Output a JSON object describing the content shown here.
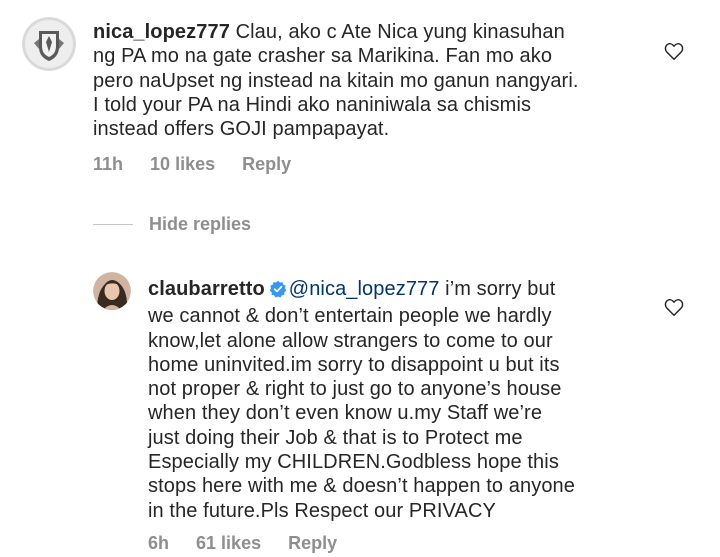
{
  "comments": [
    {
      "username": "nica_lopez777",
      "body": " Clau, ako c Ate Nica yung kinasuhan\nng PA mo na gate crasher sa Marikina. Fan mo ako\npero naUpset ng instead na kitain mo ganun nangyari.\nI told your PA na Hindi ako naniniwala sa chismis\ninstead offers GOJI pampapayat.",
      "time": "11h",
      "likes": "10 likes",
      "reply": "Reply",
      "avatar": "crest-avatar"
    },
    {
      "username": "claubarretto",
      "verified": true,
      "mention": "@nica_lopez777",
      "body_first": " i’m sorry but",
      "body": "we cannot & don’t entertain people we hardly\nknow,let alone allow strangers to come to our\nhome uninvited.im sorry to disappoint u but its\nnot proper & right to just go to anyone’s house\nwhen they don’t even know u.my Staff we’re\njust doing their Job & that is to Protect me\nEspecially my CHILDREN.Godbless hope this\nstops here with me & doesn’t happen to anyone\nin the future.Pls Respect our PRIVACY",
      "time": "6h",
      "likes": "61 likes",
      "reply": "Reply",
      "avatar": "profile-photo-avatar"
    }
  ],
  "hide_replies": "Hide replies",
  "colors": {
    "text": "#262626",
    "meta": "#8e8e8e",
    "mention": "#00376b",
    "verified": "#3897f0"
  }
}
